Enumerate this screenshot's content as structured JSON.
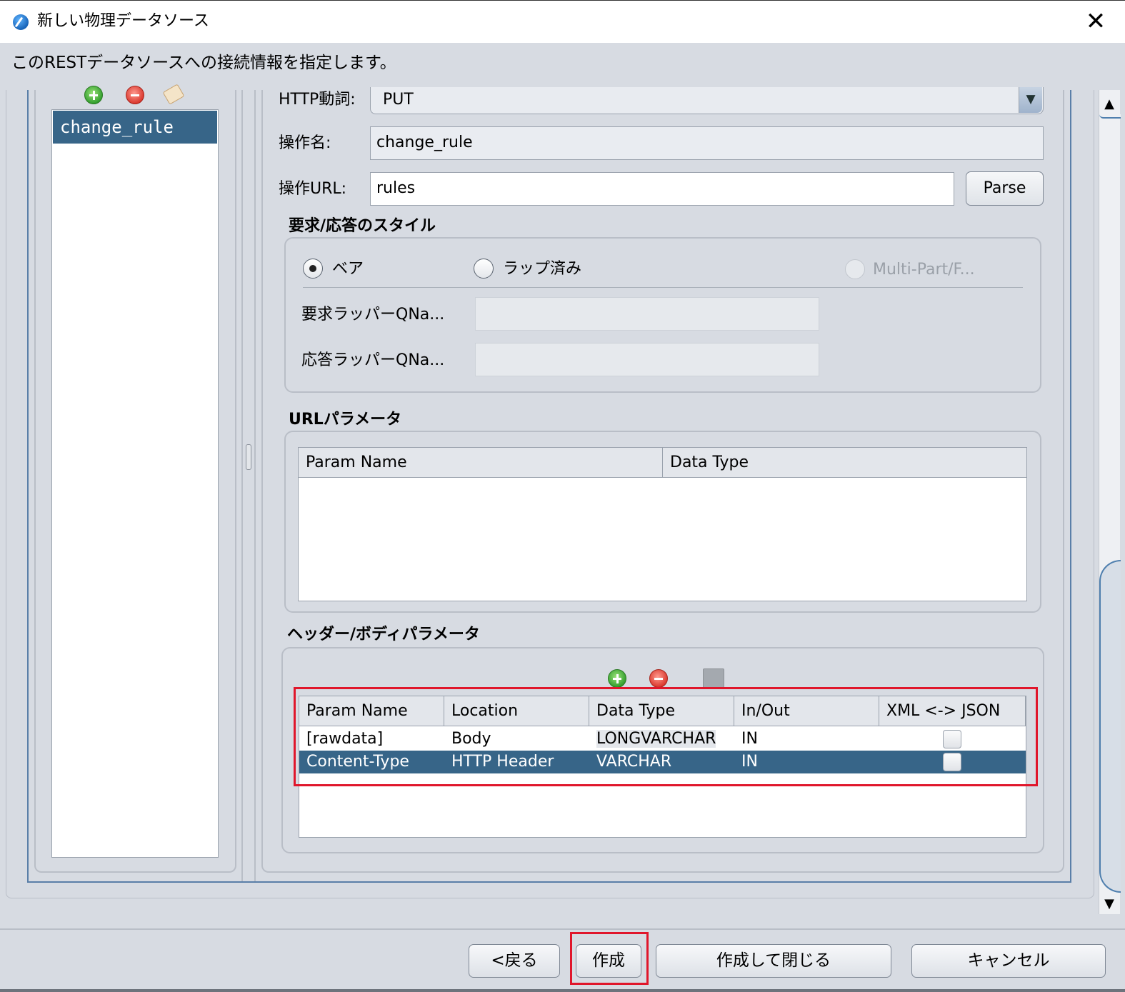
{
  "window": {
    "title": "新しい物理データソース",
    "subtitle": "このRESTデータソースへの接続情報を指定します。"
  },
  "operations": {
    "items": [
      "change_rule"
    ],
    "selected_index": 0
  },
  "form": {
    "http_verb_label": "HTTP動詞:",
    "http_verb_value": "PUT",
    "op_name_label": "操作名:",
    "op_name_value": "change_rule",
    "op_url_label": "操作URL:",
    "op_url_value": "rules",
    "parse_button": "Parse"
  },
  "style_group": {
    "title": "要求/応答のスタイル",
    "options": [
      {
        "label": "ベア",
        "checked": true,
        "enabled": true
      },
      {
        "label": "ラップ済み",
        "checked": false,
        "enabled": true
      },
      {
        "label": "Multi-Part/F...",
        "checked": false,
        "enabled": false
      }
    ],
    "request_wrapper_label": "要求ラッパーQNa...",
    "response_wrapper_label": "応答ラッパーQNa..."
  },
  "url_params": {
    "title": "URLパラメータ",
    "columns": [
      "Param Name",
      "Data Type"
    ],
    "rows": []
  },
  "header_body_params": {
    "title": "ヘッダー/ボディパラメータ",
    "columns": [
      "Param Name",
      "Location",
      "Data Type",
      "In/Out",
      "XML <-> JSON"
    ],
    "rows": [
      {
        "param_name": "[rawdata]",
        "location": "Body",
        "data_type": "LONGVARCHAR",
        "in_out": "IN",
        "xml_json": false,
        "selected": false
      },
      {
        "param_name": "Content-Type",
        "location": "HTTP Header",
        "data_type": "VARCHAR",
        "in_out": "IN",
        "xml_json": false,
        "selected": true
      }
    ]
  },
  "buttons": {
    "back": "<戻る",
    "create": "作成",
    "create_close": "作成して閉じる",
    "cancel": "キャンセル"
  },
  "scrollbar": {
    "up": "▲",
    "down": "▼"
  },
  "colors": {
    "selection": "#376588",
    "highlight": "#e0162b",
    "background": "#d7dbe2"
  },
  "icons": {
    "close": "✕",
    "dropdown": "▼"
  }
}
